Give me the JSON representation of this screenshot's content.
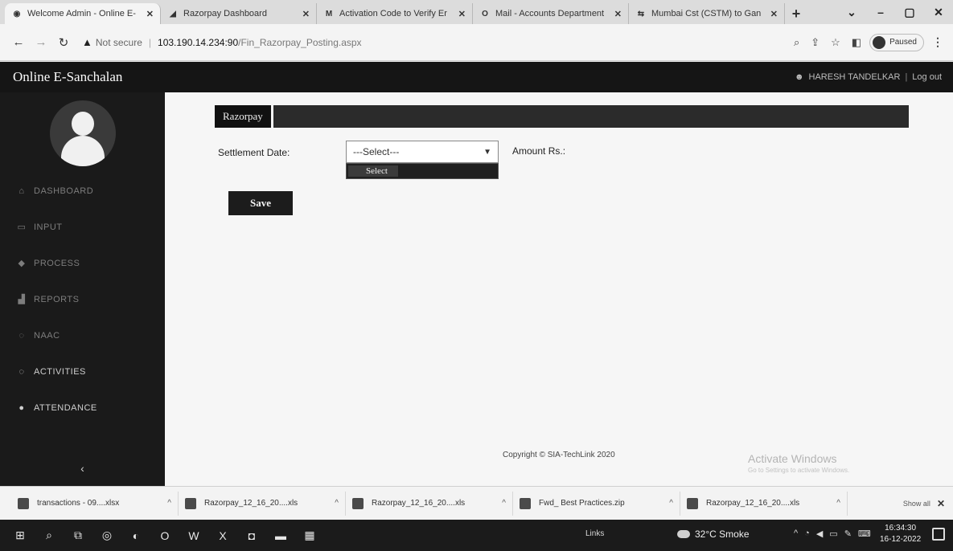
{
  "browser": {
    "tabs": [
      {
        "title": "Welcome Admin - Online E-",
        "icon": "globe-icon",
        "active": true
      },
      {
        "title": "Razorpay Dashboard",
        "icon": "razorpay-icon",
        "active": false
      },
      {
        "title": "Activation Code to Verify Er",
        "icon": "gmail-icon",
        "active": false
      },
      {
        "title": "Mail - Accounts Department",
        "icon": "outlook-icon",
        "active": false
      },
      {
        "title": "Mumbai Cst (CSTM) to Gan",
        "icon": "train-icon",
        "active": false
      }
    ],
    "address": {
      "security": "Not secure",
      "host": "103.190.14.234:90",
      "path": "/Fin_Razorpay_Posting.aspx"
    },
    "profile_status": "Paused"
  },
  "app": {
    "brand": "Online E-Sanchalan",
    "user": "HARESH TANDELKAR",
    "logout": "Log out",
    "menu": [
      {
        "label": "DASHBOARD",
        "icon": "home-icon"
      },
      {
        "label": "INPUT",
        "icon": "input-icon"
      },
      {
        "label": "PROCESS",
        "icon": "process-icon"
      },
      {
        "label": "REPORTS",
        "icon": "reports-icon"
      },
      {
        "label": "NAAC",
        "icon": "naac-icon"
      },
      {
        "label": "ACTIVITIES",
        "icon": "activities-icon"
      },
      {
        "label": "ATTENDANCE",
        "icon": "attendance-icon"
      }
    ],
    "panel_title": "Razorpay",
    "form": {
      "settlement_label": "Settlement Date:",
      "settlement_value": "---Select---",
      "dropdown_option": "Select",
      "amount_label": "Amount Rs.:",
      "save_label": "Save"
    },
    "copyright": "Copyright © SIA-TechLink 2020",
    "watermark": "Activate Windows",
    "watermark_sub": "Go to Settings to activate Windows."
  },
  "downloads": {
    "items": [
      "transactions - 09....xlsx",
      "Razorpay_12_16_20....xls",
      "Razorpay_12_16_20....xls",
      "Fwd_ Best Practices.zip",
      "Razorpay_12_16_20....xls"
    ],
    "show_all": "Show all"
  },
  "taskbar": {
    "links": "Links",
    "weather": "32°C Smoke",
    "time": "16:34:30",
    "date": "16-12-2022"
  }
}
